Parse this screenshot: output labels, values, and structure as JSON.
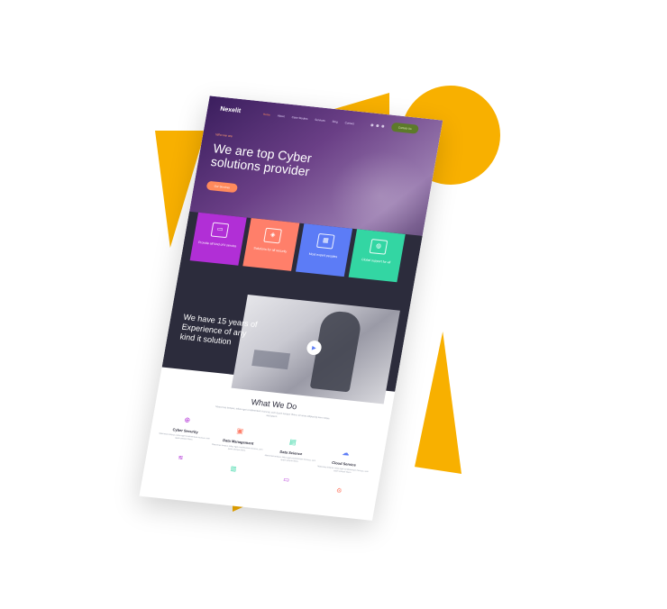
{
  "header": {
    "logo": "Nexelit",
    "nav": [
      "Home",
      "About",
      "Case Studies",
      "Services",
      "Blog",
      "Contact"
    ],
    "cta": "Contact Us"
  },
  "hero": {
    "eyebrow": "Who we are",
    "title": "We are top Cyber solutions provider",
    "button": "Our Services"
  },
  "tiles": [
    {
      "label": "Provide all kind of it service",
      "icon": "monitor-icon",
      "color": "#b12fd6"
    },
    {
      "label": "Solutions for all security",
      "icon": "shield-icon",
      "color": "#ff7f6a"
    },
    {
      "label": "Most expert peoples",
      "icon": "team-icon",
      "color": "#5c7cf6"
    },
    {
      "label": "Global support for all",
      "icon": "globe-icon",
      "color": "#33d6a3"
    }
  ],
  "experience": {
    "title": "We have 15 years of Experience of any kind it solution"
  },
  "what_we_do": {
    "title": "What We Do",
    "subtitle": "Maecenas tempus, tellus eget condimentum rhoncus, sem quam semper libero, sit amet adipiscing sem neque sed ipsum.",
    "services": [
      {
        "name": "Cyber Security",
        "desc": "Maecenas tempus, tellus eget condimentum rhoncus, sem quam semper libero.",
        "icon": "lock-icon",
        "color": "#b12fd6"
      },
      {
        "name": "Data Management",
        "desc": "Maecenas tempus, tellus eget condimentum rhoncus, sem quam semper libero.",
        "icon": "database-icon",
        "color": "#ff7f6a"
      },
      {
        "name": "Data Science",
        "desc": "Maecenas tempus, tellus eget condimentum rhoncus, sem quam semper libero.",
        "icon": "chart-icon",
        "color": "#33d6a3"
      },
      {
        "name": "Cloud Service",
        "desc": "Maecenas tempus, tellus eget condimentum rhoncus, sem quam semper libero.",
        "icon": "cloud-icon",
        "color": "#5c7cf6"
      }
    ]
  },
  "accent": "#f8b000"
}
